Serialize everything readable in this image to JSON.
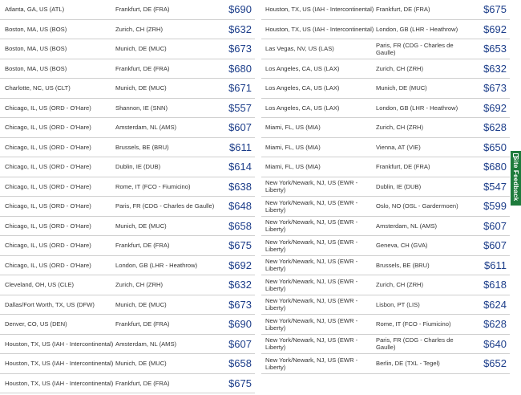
{
  "left_rows": [
    {
      "origin": "Atlanta, GA, US (ATL)",
      "dest": "Frankfurt, DE (FRA)",
      "price": "$690"
    },
    {
      "origin": "Boston, MA, US (BOS)",
      "dest": "Zurich, CH (ZRH)",
      "price": "$632"
    },
    {
      "origin": "Boston, MA, US (BOS)",
      "dest": "Munich, DE (MUC)",
      "price": "$673"
    },
    {
      "origin": "Boston, MA, US (BOS)",
      "dest": "Frankfurt, DE (FRA)",
      "price": "$680"
    },
    {
      "origin": "Charlotte, NC, US (CLT)",
      "dest": "Munich, DE (MUC)",
      "price": "$671"
    },
    {
      "origin": "Chicago, IL, US (ORD - O'Hare)",
      "dest": "Shannon, IE (SNN)",
      "price": "$557"
    },
    {
      "origin": "Chicago, IL, US (ORD - O'Hare)",
      "dest": "Amsterdam, NL (AMS)",
      "price": "$607"
    },
    {
      "origin": "Chicago, IL, US (ORD - O'Hare)",
      "dest": "Brussels, BE (BRU)",
      "price": "$611"
    },
    {
      "origin": "Chicago, IL, US (ORD - O'Hare)",
      "dest": "Dublin, IE (DUB)",
      "price": "$614"
    },
    {
      "origin": "Chicago, IL, US (ORD - O'Hare)",
      "dest": "Rome, IT (FCO - Fiumicino)",
      "price": "$638"
    },
    {
      "origin": "Chicago, IL, US (ORD - O'Hare)",
      "dest": "Paris, FR (CDG - Charles de Gaulle)",
      "price": "$648"
    },
    {
      "origin": "Chicago, IL, US (ORD - O'Hare)",
      "dest": "Munich, DE (MUC)",
      "price": "$658"
    },
    {
      "origin": "Chicago, IL, US (ORD - O'Hare)",
      "dest": "Frankfurt, DE (FRA)",
      "price": "$675"
    },
    {
      "origin": "Chicago, IL, US (ORD - O'Hare)",
      "dest": "London, GB (LHR - Heathrow)",
      "price": "$692"
    },
    {
      "origin": "Cleveland, OH, US (CLE)",
      "dest": "Zurich, CH (ZRH)",
      "price": "$632"
    },
    {
      "origin": "Dallas/Fort Worth, TX, US (DFW)",
      "dest": "Munich, DE (MUC)",
      "price": "$673"
    },
    {
      "origin": "Denver, CO, US (DEN)",
      "dest": "Frankfurt, DE (FRA)",
      "price": "$690"
    },
    {
      "origin": "Houston, TX, US (IAH - Intercontinental)",
      "dest": "Amsterdam, NL (AMS)",
      "price": "$607"
    },
    {
      "origin": "Houston, TX, US (IAH - Intercontinental)",
      "dest": "Munich, DE (MUC)",
      "price": "$658"
    },
    {
      "origin": "Houston, TX, US (IAH - Intercontinental)",
      "dest": "Frankfurt, DE (FRA)",
      "price": "$675"
    }
  ],
  "right_rows": [
    {
      "origin": "Houston, TX, US (IAH - Intercontinental)",
      "dest": "Frankfurt, DE (FRA)",
      "price": "$675"
    },
    {
      "origin": "Houston, TX, US (IAH - Intercontinental)",
      "dest": "London, GB (LHR - Heathrow)",
      "price": "$692"
    },
    {
      "origin": "Las Vegas, NV, US (LAS)",
      "dest": "Paris, FR (CDG - Charles de Gaulle)",
      "price": "$653"
    },
    {
      "origin": "Los Angeles, CA, US (LAX)",
      "dest": "Zurich, CH (ZRH)",
      "price": "$632"
    },
    {
      "origin": "Los Angeles, CA, US (LAX)",
      "dest": "Munich, DE (MUC)",
      "price": "$673"
    },
    {
      "origin": "Los Angeles, CA, US (LAX)",
      "dest": "London, GB (LHR - Heathrow)",
      "price": "$692"
    },
    {
      "origin": "Miami, FL, US (MIA)",
      "dest": "Zurich, CH (ZRH)",
      "price": "$628"
    },
    {
      "origin": "Miami, FL, US (MIA)",
      "dest": "Vienna, AT (VIE)",
      "price": "$650"
    },
    {
      "origin": "Miami, FL, US (MIA)",
      "dest": "Frankfurt, DE (FRA)",
      "price": "$680"
    },
    {
      "origin": "New York/Newark, NJ, US (EWR - Liberty)",
      "dest": "Dublin, IE (DUB)",
      "price": "$547"
    },
    {
      "origin": "New York/Newark, NJ, US (EWR - Liberty)",
      "dest": "Oslo, NO (OSL - Gardermoen)",
      "price": "$599"
    },
    {
      "origin": "New York/Newark, NJ, US (EWR - Liberty)",
      "dest": "Amsterdam, NL (AMS)",
      "price": "$607"
    },
    {
      "origin": "New York/Newark, NJ, US (EWR - Liberty)",
      "dest": "Geneva, CH (GVA)",
      "price": "$607"
    },
    {
      "origin": "New York/Newark, NJ, US (EWR - Liberty)",
      "dest": "Brussels, BE (BRU)",
      "price": "$611"
    },
    {
      "origin": "New York/Newark, NJ, US (EWR - Liberty)",
      "dest": "Zurich, CH (ZRH)",
      "price": "$618"
    },
    {
      "origin": "New York/Newark, NJ, US (EWR - Liberty)",
      "dest": "Lisbon, PT (LIS)",
      "price": "$624"
    },
    {
      "origin": "New York/Newark, NJ, US (EWR - Liberty)",
      "dest": "Rome, IT (FCO - Fiumicino)",
      "price": "$628"
    },
    {
      "origin": "New York/Newark, NJ, US (EWR - Liberty)",
      "dest": "Paris, FR (CDG - Charles de Gaulle)",
      "price": "$640"
    },
    {
      "origin": "New York/Newark, NJ, US (EWR - Liberty)",
      "dest": "Berlin, DE (TXL - Tegel)",
      "price": "$652"
    }
  ],
  "feedback": {
    "label": "Site Feedback",
    "icon": "chat-icon"
  },
  "colors": {
    "price": "#1d3e8a",
    "feedback_bg": "#1e7b3c",
    "divider": "#cfcfcf"
  }
}
